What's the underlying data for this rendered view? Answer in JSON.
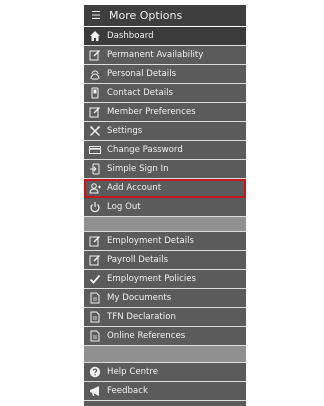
{
  "header": {
    "title": "More Options"
  },
  "menu_group_1": [
    {
      "label": "Dashboard",
      "icon": "home-icon"
    },
    {
      "label": "Permanent Availability",
      "icon": "edit-icon"
    },
    {
      "label": "Personal Details",
      "icon": "person-icon"
    },
    {
      "label": "Contact Details",
      "icon": "phone-icon"
    },
    {
      "label": "Member Preferences",
      "icon": "edit-icon"
    },
    {
      "label": "Settings",
      "icon": "tools-icon"
    },
    {
      "label": "Change Password",
      "icon": "card-icon"
    },
    {
      "label": "Simple Sign In",
      "icon": "signin-icon"
    },
    {
      "label": "Add Account",
      "icon": "user-add-icon"
    },
    {
      "label": "Log Out",
      "icon": "power-icon"
    }
  ],
  "menu_group_2": [
    {
      "label": "Employment Details",
      "icon": "edit-icon"
    },
    {
      "label": "Payroll Details",
      "icon": "edit-icon"
    },
    {
      "label": "Employment Policies",
      "icon": "check-icon"
    },
    {
      "label": "My Documents",
      "icon": "document-icon"
    },
    {
      "label": "TFN Declaration",
      "icon": "document-icon"
    },
    {
      "label": "Online References",
      "icon": "document-icon"
    }
  ],
  "menu_group_3": [
    {
      "label": "Help Centre",
      "icon": "help-icon"
    },
    {
      "label": "Feedback",
      "icon": "megaphone-icon"
    }
  ],
  "colors": {
    "highlight": "#c4161c",
    "panel": "#5b5b5b",
    "header": "#3e3e3e",
    "separator": "#909090"
  }
}
